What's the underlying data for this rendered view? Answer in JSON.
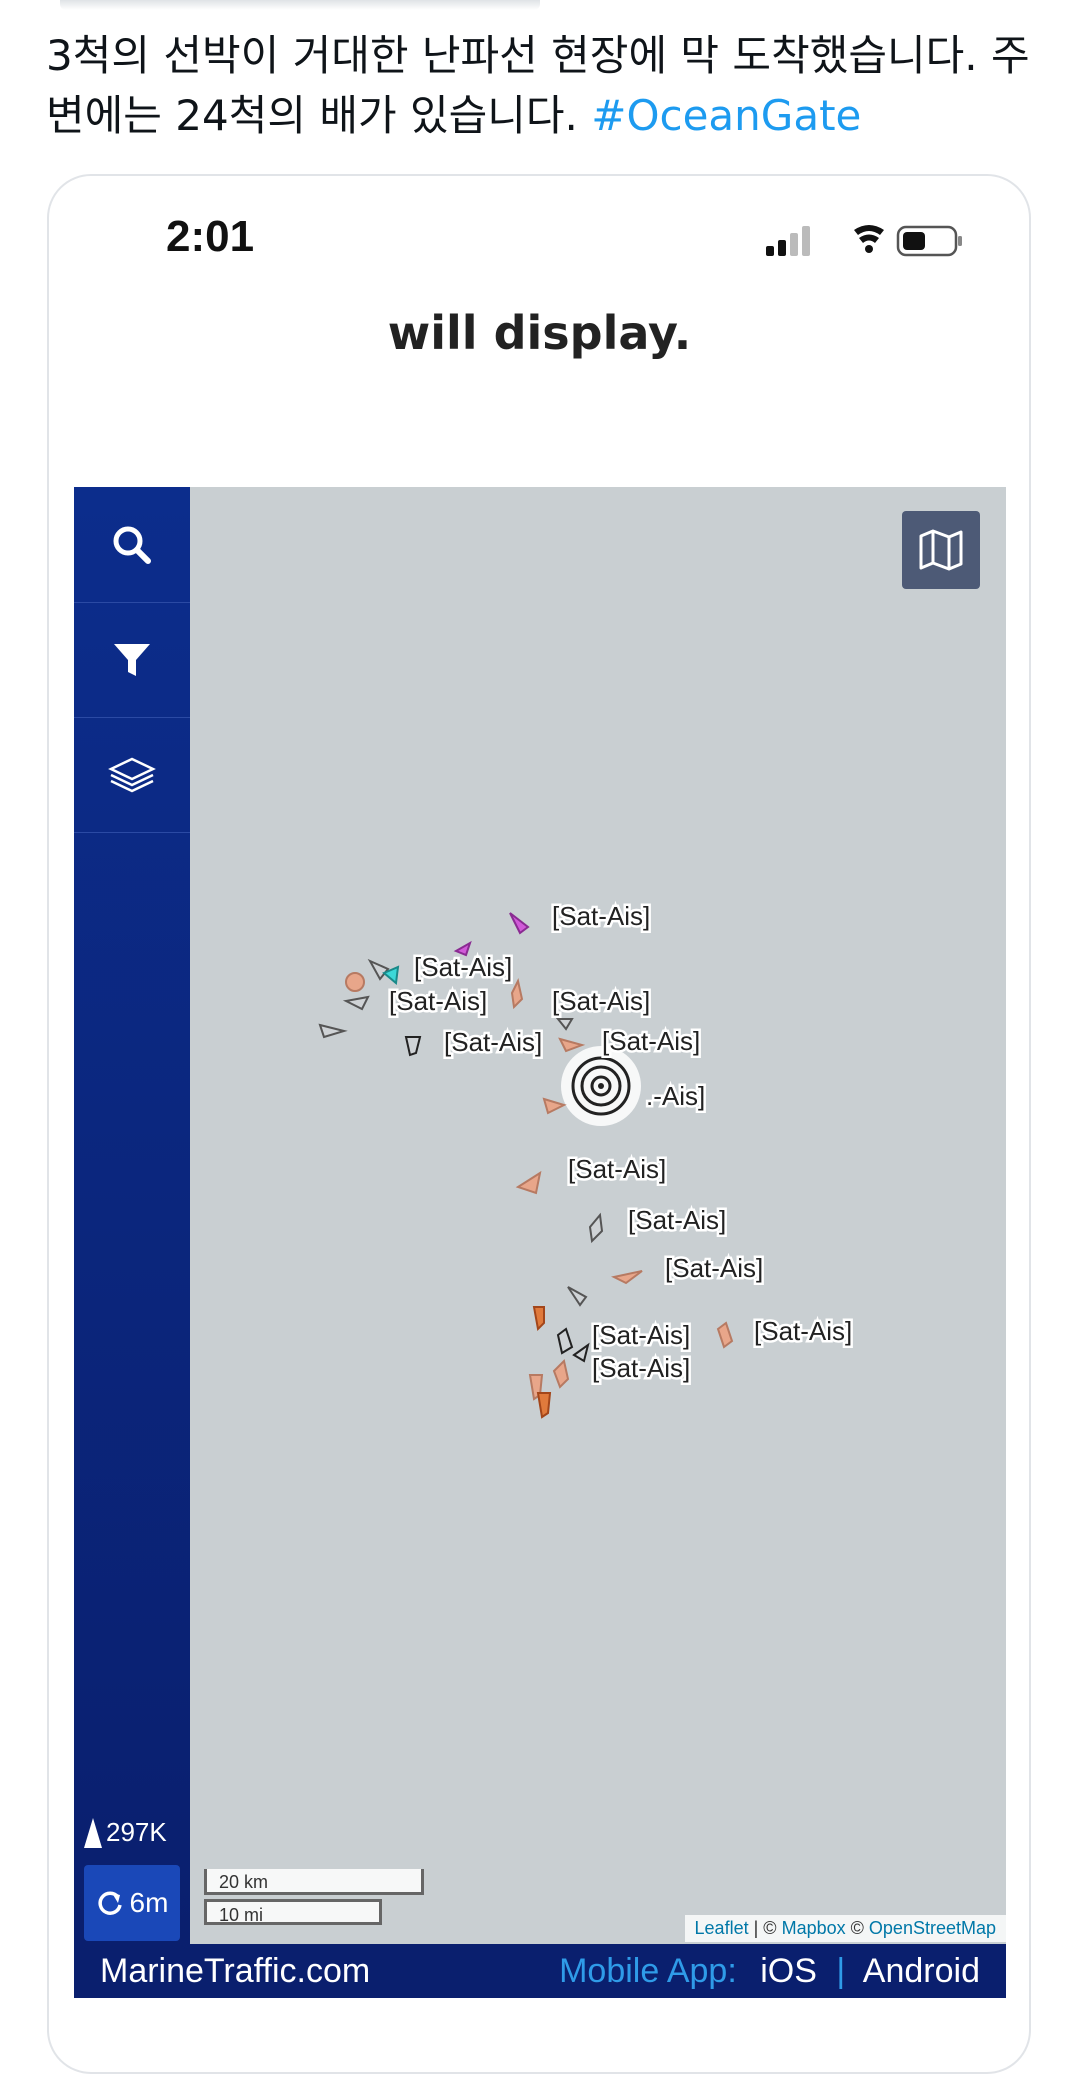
{
  "tweet": {
    "text": "3척의 선박이 거대한 난파선 현장에 막 도착했습니다. 주변에는 24척의 배가 있습니다.",
    "hashtag": "#OceanGate"
  },
  "status_bar": {
    "time": "2:01"
  },
  "headline": "will display.",
  "map": {
    "sidebar": {
      "buttons": [
        {
          "name": "search",
          "icon": "search-icon"
        },
        {
          "name": "filter",
          "icon": "filter-icon"
        },
        {
          "name": "layers",
          "icon": "layers-icon"
        }
      ],
      "vessel_count": "297K",
      "refresh_label": "6m"
    },
    "vessel_label": "[Sat-Ais]",
    "partial_label": ".-Ais]",
    "scale": {
      "km": "20 km",
      "mi": "10 mi"
    },
    "attribution": {
      "leaflet": "Leaflet",
      "separator": "|",
      "copyright": "©",
      "mapbox": "Mapbox",
      "osm": "OpenStreetMap"
    }
  },
  "footer": {
    "brand": "MarineTraffic.com",
    "mobile_label": "Mobile App:",
    "ios": "iOS",
    "separator": "|",
    "android": "Android"
  },
  "colors": {
    "sidebar": "#0a1f6e",
    "map_water": "#c9cfd2",
    "hashtag": "#1d9bf0",
    "footer_link": "#2f9be8",
    "vessel_tanker": "#e8a68a",
    "vessel_passenger": "#d05ad8",
    "vessel_unknown": "#cfd3d6",
    "vessel_fishing": "#e07a3c"
  }
}
